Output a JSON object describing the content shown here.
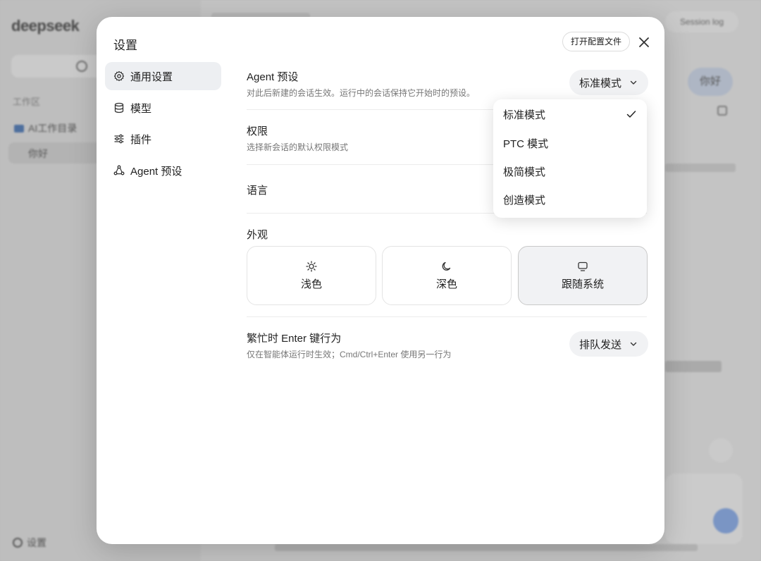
{
  "background": {
    "logo": "deepseek",
    "section_label": "工作区",
    "folder_label": "AI工作目录",
    "chat_item": "你好",
    "settings_label": "设置",
    "session_log": "Session log",
    "bubble_text": "你好"
  },
  "modal": {
    "title": "设置",
    "open_config_label": "打开配置文件",
    "close_icon": "close-icon"
  },
  "nav": {
    "items": [
      {
        "label": "通用设置",
        "icon": "gear-icon",
        "active": true
      },
      {
        "label": "模型",
        "icon": "database-icon",
        "active": false
      },
      {
        "label": "插件",
        "icon": "sliders-icon",
        "active": false
      },
      {
        "label": "Agent 预设",
        "icon": "agent-icon",
        "active": false
      }
    ]
  },
  "settings": {
    "agent_preset": {
      "title": "Agent 预设",
      "description": "对此后新建的会话生效。运行中的会话保持它开始时的预设。",
      "selected": "标准模式"
    },
    "permissions": {
      "title": "权限",
      "description": "选择新会话的默认权限模式"
    },
    "language": {
      "title": "语言"
    },
    "appearance": {
      "title": "外观",
      "options": [
        {
          "label": "浅色",
          "icon": "sun-icon"
        },
        {
          "label": "深色",
          "icon": "moon-icon"
        },
        {
          "label": "跟随系统",
          "icon": "monitor-icon"
        }
      ],
      "selected": "跟随系统"
    },
    "busy_enter": {
      "title": "繁忙时 Enter 键行为",
      "description": "仅在智能体运行时生效；Cmd/Ctrl+Enter 使用另一行为",
      "selected": "排队发送"
    }
  },
  "dropdown": {
    "options": [
      "标准模式",
      "PTC 模式",
      "极简模式",
      "创造模式"
    ],
    "checked": "标准模式"
  }
}
